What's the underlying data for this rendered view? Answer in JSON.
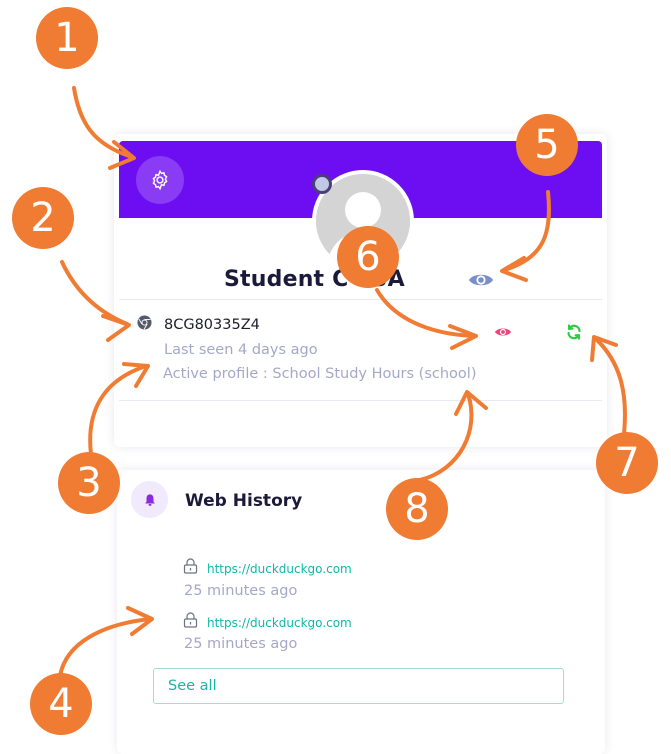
{
  "student_card": {
    "name": "Student C TSA",
    "device_id": "8CG80335Z4",
    "last_seen": "Last seen 4 days ago",
    "active_profile": "Active profile : School Study Hours (school)"
  },
  "web_history": {
    "title": "Web History",
    "entries": [
      {
        "url": "https://duckduckgo.com",
        "time": "25 minutes ago"
      },
      {
        "url": "https://duckduckgo.com",
        "time": "25 minutes ago"
      }
    ],
    "see_all_label": "See all"
  },
  "callouts": [
    "1",
    "2",
    "3",
    "4",
    "5",
    "6",
    "7",
    "8"
  ],
  "icons": {
    "settings": "gear-icon",
    "avatar": "user-avatar",
    "visibility": "eye-icon",
    "browser": "chrome-icon",
    "refresh": "refresh-icon",
    "notifications": "bell-icon",
    "lock": "lock-icon"
  },
  "colors": {
    "banner": "#6d0df2",
    "callout": "#ef7c32",
    "accent_teal": "#10b7a9",
    "eye_primary": "#7b8ec8",
    "eye_pink": "#f0457a",
    "refresh_green": "#2ecc40",
    "muted_text": "#a4a8c8"
  }
}
